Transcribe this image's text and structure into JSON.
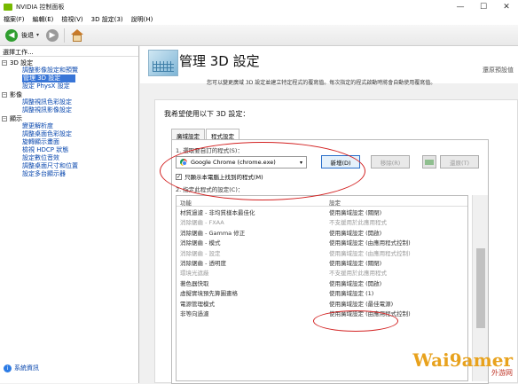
{
  "window": {
    "title": "NVIDIA 控制面板",
    "buttons": [
      "—",
      "☐",
      "✕"
    ]
  },
  "menu": [
    "檔案(F)",
    "編輯(E)",
    "檢視(V)",
    "3D 設定(3)",
    "說明(H)"
  ],
  "toolbar": {
    "back_label": "後退"
  },
  "left": {
    "header": "選擇工作...",
    "tree": [
      {
        "category": "3D 設定",
        "expander": "−",
        "items": [
          {
            "label": "調整影像設定和預覽",
            "selected": false
          },
          {
            "label": "管理 3D 設定",
            "selected": true
          },
          {
            "label": "設定 PhysX 設定",
            "selected": false
          }
        ]
      },
      {
        "category": "影像",
        "expander": "−",
        "items": [
          {
            "label": "調整視訊色彩設定",
            "selected": false
          },
          {
            "label": "調整視訊影像設定",
            "selected": false
          }
        ]
      },
      {
        "category": "顯示",
        "expander": "−",
        "items": [
          {
            "label": "變更解析度",
            "selected": false
          },
          {
            "label": "調整桌面色彩設定",
            "selected": false
          },
          {
            "label": "旋轉顯示畫面",
            "selected": false
          },
          {
            "label": "檢視 HDCP 狀態",
            "selected": false
          },
          {
            "label": "設定數位音效",
            "selected": false
          },
          {
            "label": "調整桌面尺寸和位置",
            "selected": false
          },
          {
            "label": "設定多台顯示器",
            "selected": false
          }
        ]
      }
    ],
    "sysinfo": "系統資訊"
  },
  "main": {
    "title": "管理 3D 設定",
    "restore": "還原預設值",
    "description": "您可以變更廣域 3D 設定並建立特定程式的覆寫值。每次指定的程式啟動時將會自動使用覆寫值。",
    "heading": "我希望使用以下 3D 設定：",
    "tabs": [
      {
        "label": "廣域設定",
        "active": false
      },
      {
        "label": "程式設定",
        "active": true
      }
    ],
    "step1": "1. 選取要自訂的程式(S)：",
    "program": "Google Chrome (chrome.exe)",
    "buttons": {
      "add": "新增(D)",
      "remove": "移除(R)",
      "restore": "還原(T)"
    },
    "checkbox": "只顯示本電腦上找到的程式(M)",
    "step2": "2. 指定此程式的設定(C)：",
    "columns": [
      "功能",
      "設定"
    ],
    "rows": [
      {
        "feature": "材質過濾 - 非均質樣本最佳化",
        "setting": "使用廣域設定 (關閉)",
        "dim": false
      },
      {
        "feature": "消除鋸齒 - FXAA",
        "setting": "不支援用於此應用程式",
        "dim": true
      },
      {
        "feature": "消除鋸齒 - Gamma 修正",
        "setting": "使用廣域設定 (開啟)",
        "dim": false
      },
      {
        "feature": "消除鋸齒 - 模式",
        "setting": "使用廣域設定 (由應用程式控制)",
        "dim": false
      },
      {
        "feature": "消除鋸齒 - 設定",
        "setting": "使用廣域設定 (由應用程式控制)",
        "dim": true
      },
      {
        "feature": "消除鋸齒 - 透明度",
        "setting": "使用廣域設定 (關閉)",
        "dim": false
      },
      {
        "feature": "環境光遮蔽",
        "setting": "不支援用於此應用程式",
        "dim": true
      },
      {
        "feature": "著色器快取",
        "setting": "使用廣域設定 (開啟)",
        "dim": false
      },
      {
        "feature": "虛擬實境預先算圖畫格",
        "setting": "使用廣域設定 (1)",
        "dim": false
      },
      {
        "feature": "電源管理模式",
        "setting": "使用廣域設定 (最佳電源)",
        "dim": false
      },
      {
        "feature": "非等向過濾",
        "setting": "使用廣域設定 (由應用程式控制)",
        "dim": false
      }
    ]
  },
  "watermark": {
    "brand": "Wai9amer",
    "site": "外游网"
  }
}
